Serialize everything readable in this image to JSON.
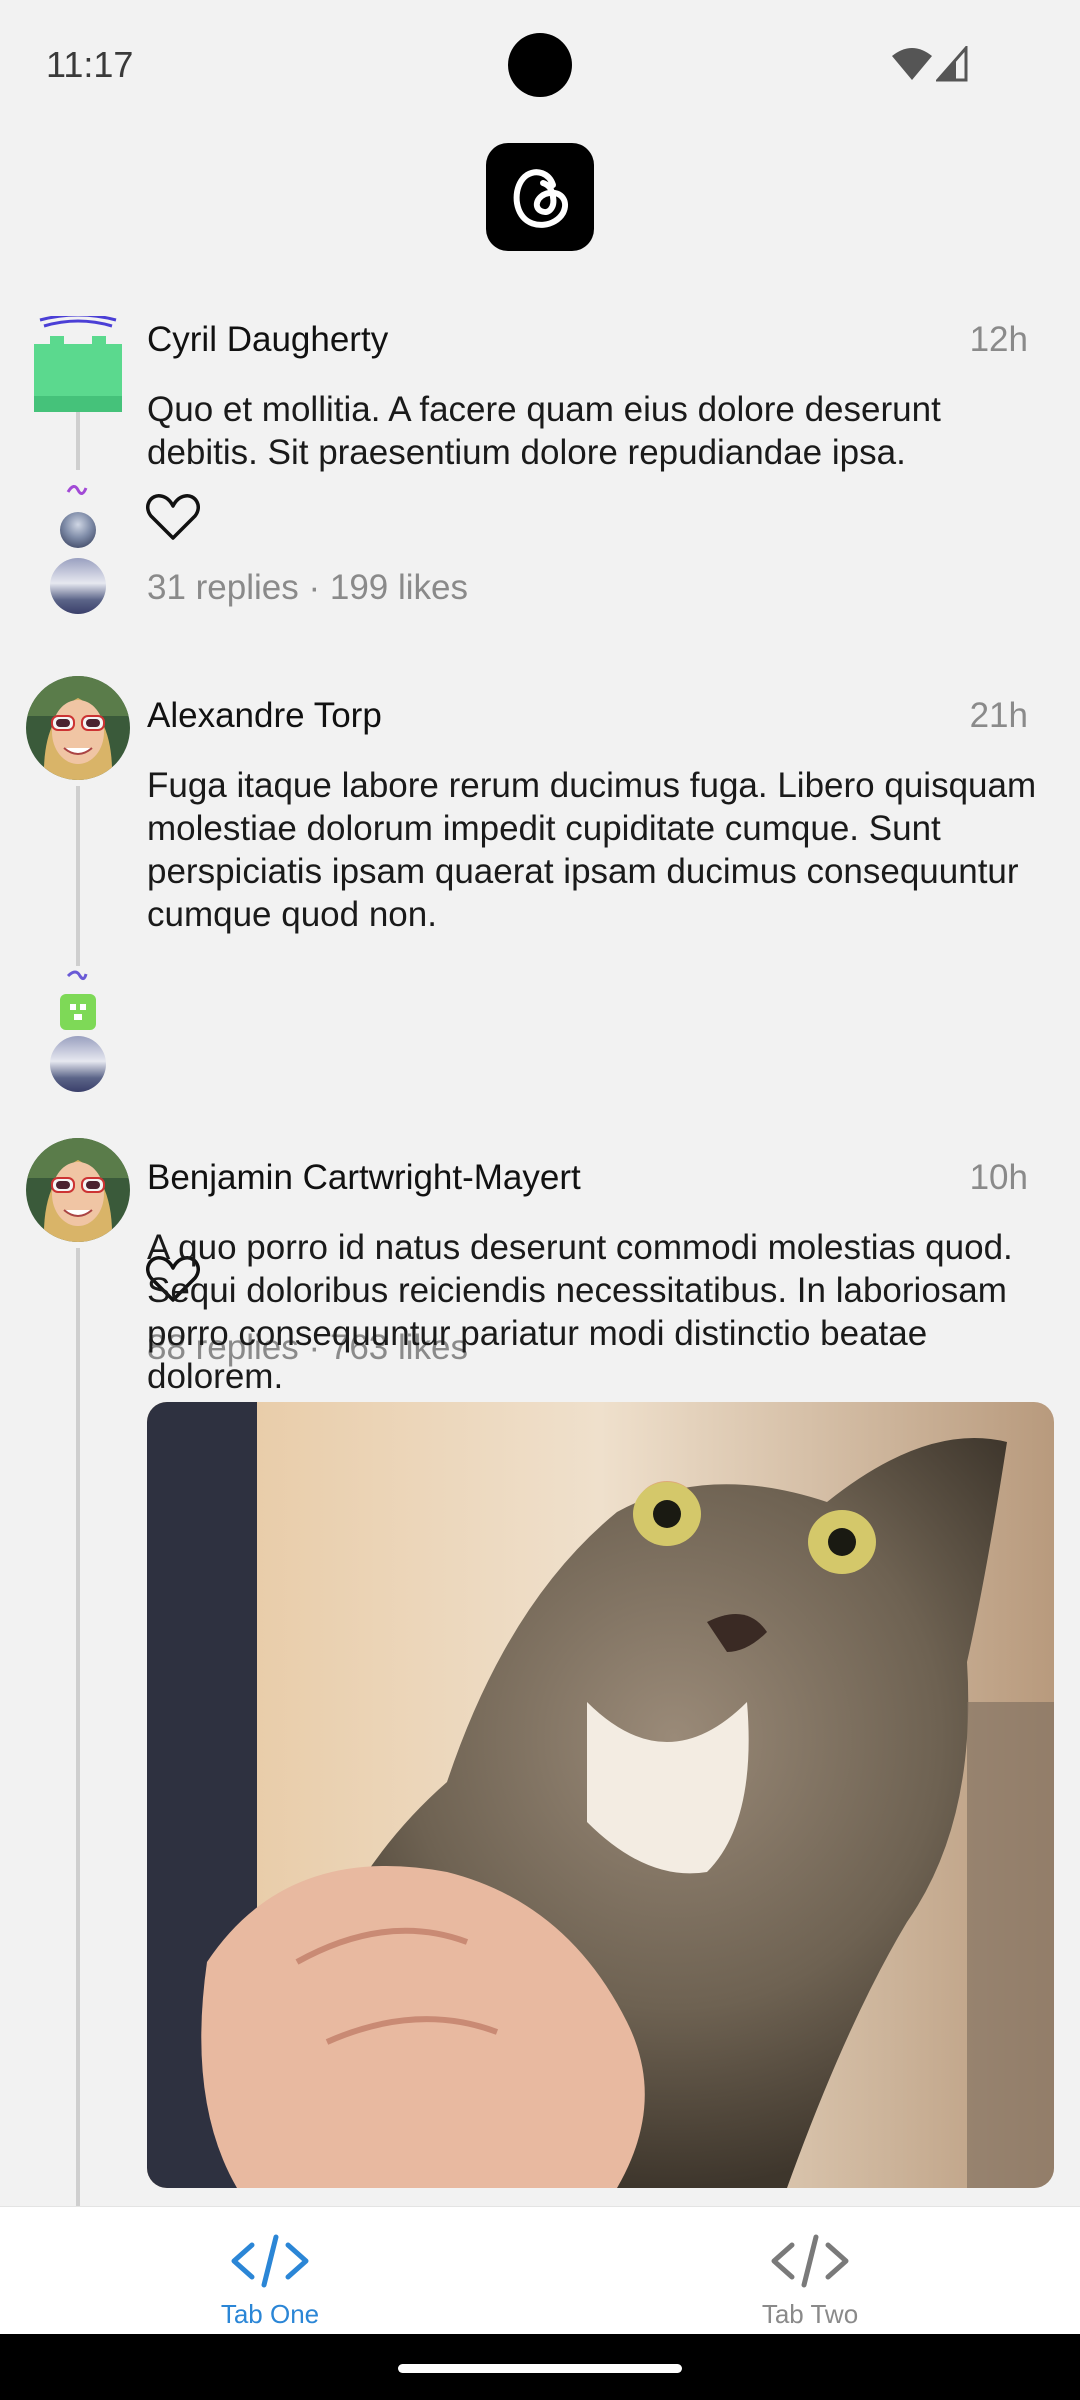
{
  "status_bar": {
    "time": "11:17"
  },
  "header": {
    "logo_icon": "threads-logo-icon"
  },
  "posts": [
    {
      "author": "Cyril Daugherty",
      "time": "12h",
      "text": "Quo et mollitia. A facere quam eius dolore deserunt debitis. Sit praesentium dolore repudiandae ipsa.",
      "stats": "31 replies · 199 likes",
      "avatar_icon": "castle-avatar-icon",
      "accent": "#5bd98e"
    },
    {
      "author": "Alexandre Torp",
      "time": "21h",
      "text": "Fuga itaque labore rerum ducimus fuga. Libero quisquam molestiae dolorum impedit cupiditate cumque. Sunt perspiciatis ipsam quaerat ipsam ducimus consequuntur cumque quod non.",
      "stats": "88 replies · 763 likes"
    },
    {
      "author": "Benjamin Cartwright-Mayert",
      "time": "10h",
      "text": "A quo porro id natus deserunt commodi molestias quod. Sequi doloribus reiciendis necessitatibus. In laboriosam porro consequuntur pariatur modi distinctio beatae dolorem.",
      "image_icon": "kitten-photo"
    }
  ],
  "tabs": [
    {
      "label": "Tab One",
      "icon": "code-icon",
      "active": true
    },
    {
      "label": "Tab Two",
      "icon": "code-icon",
      "active": false
    }
  ],
  "colors": {
    "accent": "#2b86d6",
    "background": "#f2f2f2",
    "muted_text": "#8a8a8a"
  }
}
